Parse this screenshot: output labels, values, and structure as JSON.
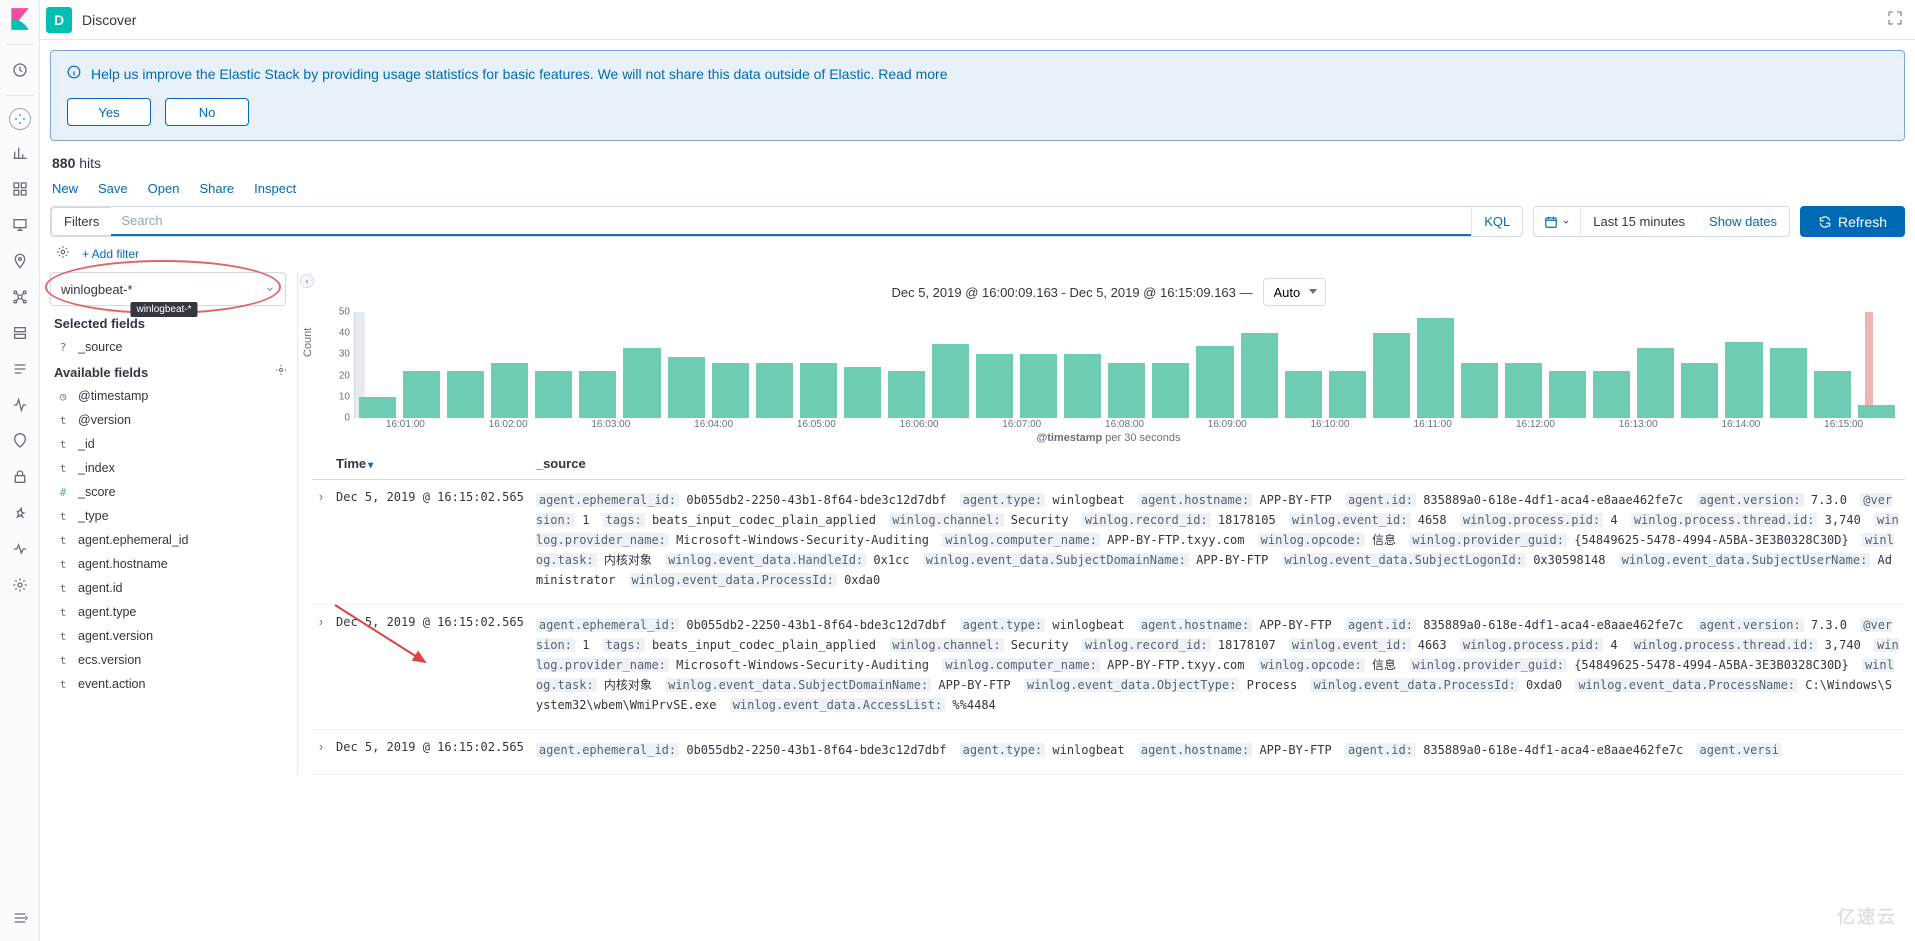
{
  "header": {
    "app_letter": "D",
    "title": "Discover"
  },
  "callout": {
    "text": "Help us improve the Elastic Stack by providing usage statistics for basic features. We will not share this data outside of Elastic. Read more",
    "yes": "Yes",
    "no": "No"
  },
  "hits": {
    "count": "880",
    "label": "hits"
  },
  "toolbar_links": [
    "New",
    "Save",
    "Open",
    "Share",
    "Inspect"
  ],
  "search": {
    "filters_label": "Filters",
    "placeholder": "Search",
    "kql": "KQL",
    "date_text": "Last 15 minutes",
    "show_dates": "Show dates",
    "refresh": "Refresh"
  },
  "add_filter": "+ Add filter",
  "index_pattern": {
    "selected": "winlogbeat-*",
    "tooltip": "winlogbeat-*"
  },
  "selected_fields_header": "Selected fields",
  "selected_fields": [
    {
      "type": "?",
      "name": "_source"
    }
  ],
  "available_fields_header": "Available fields",
  "available_fields": [
    {
      "type": "◷",
      "name": "@timestamp"
    },
    {
      "type": "t",
      "name": "@version"
    },
    {
      "type": "t",
      "name": "_id"
    },
    {
      "type": "t",
      "name": "_index"
    },
    {
      "type": "#",
      "name": "_score"
    },
    {
      "type": "t",
      "name": "_type"
    },
    {
      "type": "t",
      "name": "agent.ephemeral_id"
    },
    {
      "type": "t",
      "name": "agent.hostname"
    },
    {
      "type": "t",
      "name": "agent.id"
    },
    {
      "type": "t",
      "name": "agent.type"
    },
    {
      "type": "t",
      "name": "agent.version"
    },
    {
      "type": "t",
      "name": "ecs.version"
    },
    {
      "type": "t",
      "name": "event.action"
    }
  ],
  "range_text": "Dec 5, 2019 @ 16:00:09.163 - Dec 5, 2019 @ 16:15:09.163 —",
  "interval": "Auto",
  "chart_data": {
    "type": "bar",
    "ylabel": "Count",
    "xlabel_field": "@timestamp",
    "xlabel_suffix": "per 30 seconds",
    "ylim": [
      0,
      50
    ],
    "yticks": [
      0,
      10,
      20,
      30,
      40,
      50
    ],
    "x_major_labels": [
      "16:01:00",
      "16:02:00",
      "16:03:00",
      "16:04:00",
      "16:05:00",
      "16:06:00",
      "16:07:00",
      "16:08:00",
      "16:09:00",
      "16:10:00",
      "16:11:00",
      "16:12:00",
      "16:13:00",
      "16:14:00",
      "16:15:00"
    ],
    "values": [
      10,
      22,
      22,
      26,
      22,
      22,
      33,
      29,
      26,
      26,
      26,
      24,
      22,
      35,
      30,
      30,
      30,
      26,
      26,
      34,
      40,
      22,
      22,
      40,
      47,
      26,
      26,
      22,
      22,
      33,
      26,
      36,
      33,
      22,
      6
    ]
  },
  "table": {
    "cols": {
      "time": "Time",
      "source": "_source"
    },
    "rows": [
      {
        "time": "Dec 5, 2019 @ 16:15:02.565",
        "kv": [
          [
            "agent.ephemeral_id:",
            "0b055db2-2250-43b1-8f64-bde3c12d7dbf"
          ],
          [
            "agent.type:",
            "winlogbeat"
          ],
          [
            "agent.hostname:",
            "APP-BY-FTP"
          ],
          [
            "agent.id:",
            "835889a0-618e-4df1-aca4-e8aae462fe7c"
          ],
          [
            "agent.version:",
            "7.3.0"
          ],
          [
            "@version:",
            "1"
          ],
          [
            "tags:",
            "beats_input_codec_plain_applied"
          ],
          [
            "winlog.channel:",
            "Security"
          ],
          [
            "winlog.record_id:",
            "18178105"
          ],
          [
            "winlog.event_id:",
            "4658"
          ],
          [
            "winlog.process.pid:",
            "4"
          ],
          [
            "winlog.process.thread.id:",
            "3,740"
          ],
          [
            "winlog.provider_name:",
            "Microsoft-Windows-Security-Auditing"
          ],
          [
            "winlog.computer_name:",
            "APP-BY-FTP.txyy.com"
          ],
          [
            "winlog.opcode:",
            "信息"
          ],
          [
            "winlog.provider_guid:",
            "{54849625-5478-4994-A5BA-3E3B0328C30D}"
          ],
          [
            "winlog.task:",
            "内核对象"
          ],
          [
            "winlog.event_data.HandleId:",
            "0x1cc"
          ],
          [
            "winlog.event_data.SubjectDomainName:",
            "APP-BY-FTP"
          ],
          [
            "winlog.event_data.SubjectLogonId:",
            "0x30598148"
          ],
          [
            "winlog.event_data.SubjectUserName:",
            "Administrator"
          ],
          [
            "winlog.event_data.ProcessId:",
            "0xda0"
          ]
        ]
      },
      {
        "time": "Dec 5, 2019 @ 16:15:02.565",
        "kv": [
          [
            "agent.ephemeral_id:",
            "0b055db2-2250-43b1-8f64-bde3c12d7dbf"
          ],
          [
            "agent.type:",
            "winlogbeat"
          ],
          [
            "agent.hostname:",
            "APP-BY-FTP"
          ],
          [
            "agent.id:",
            "835889a0-618e-4df1-aca4-e8aae462fe7c"
          ],
          [
            "agent.version:",
            "7.3.0"
          ],
          [
            "@version:",
            "1"
          ],
          [
            "tags:",
            "beats_input_codec_plain_applied"
          ],
          [
            "winlog.channel:",
            "Security"
          ],
          [
            "winlog.record_id:",
            "18178107"
          ],
          [
            "winlog.event_id:",
            "4663"
          ],
          [
            "winlog.process.pid:",
            "4"
          ],
          [
            "winlog.process.thread.id:",
            "3,740"
          ],
          [
            "winlog.provider_name:",
            "Microsoft-Windows-Security-Auditing"
          ],
          [
            "winlog.computer_name:",
            "APP-BY-FTP.txyy.com"
          ],
          [
            "winlog.opcode:",
            "信息"
          ],
          [
            "winlog.provider_guid:",
            "{54849625-5478-4994-A5BA-3E3B0328C30D}"
          ],
          [
            "winlog.task:",
            "内核对象"
          ],
          [
            "winlog.event_data.SubjectDomainName:",
            "APP-BY-FTP"
          ],
          [
            "winlog.event_data.ObjectType:",
            "Process"
          ],
          [
            "winlog.event_data.ProcessId:",
            "0xda0"
          ],
          [
            "winlog.event_data.ProcessName:",
            "C:\\Windows\\System32\\wbem\\WmiPrvSE.exe"
          ],
          [
            "winlog.event_data.AccessList:",
            "%%4484"
          ]
        ]
      },
      {
        "time": "Dec 5, 2019 @ 16:15:02.565",
        "kv": [
          [
            "agent.ephemeral_id:",
            "0b055db2-2250-43b1-8f64-bde3c12d7dbf"
          ],
          [
            "agent.type:",
            "winlogbeat"
          ],
          [
            "agent.hostname:",
            "APP-BY-FTP"
          ],
          [
            "agent.id:",
            "835889a0-618e-4df1-aca4-e8aae462fe7c"
          ],
          [
            "agent.versi",
            ""
          ]
        ]
      }
    ]
  },
  "watermark": "亿速云"
}
